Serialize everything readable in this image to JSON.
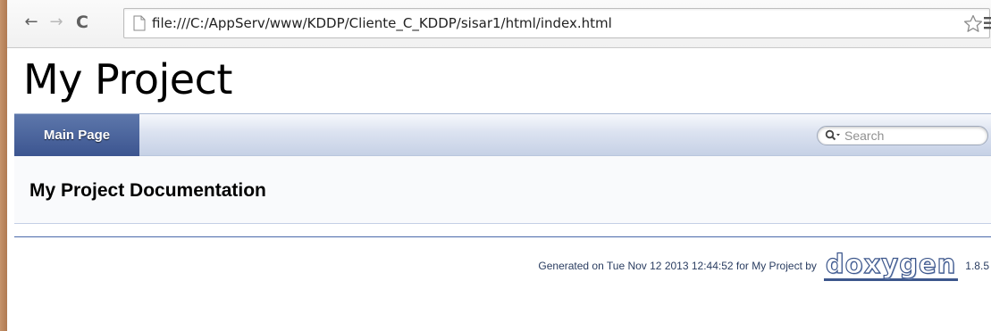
{
  "browser": {
    "url": "file:///C:/AppServ/www/KDDP/Cliente_C_KDDP/sisar1/html/index.html",
    "back_icon": "←",
    "forward_icon": "→",
    "reload_icon": "C"
  },
  "page": {
    "project_title": "My Project",
    "nav": {
      "tabs": [
        {
          "label": "Main Page",
          "active": true
        }
      ],
      "search_placeholder": "Search"
    },
    "doc_title": "My Project Documentation",
    "footer": {
      "generated_text": "Generated on Tue Nov 12 2013 12:44:52 for My Project by",
      "logo_text": "doxygen",
      "version": "1.8.5"
    }
  },
  "colors": {
    "tab_active": "#3c5590",
    "navbar": "#c6d1e6",
    "footer_rule": "#4a6aaa",
    "window_frame": "#c5936b"
  }
}
